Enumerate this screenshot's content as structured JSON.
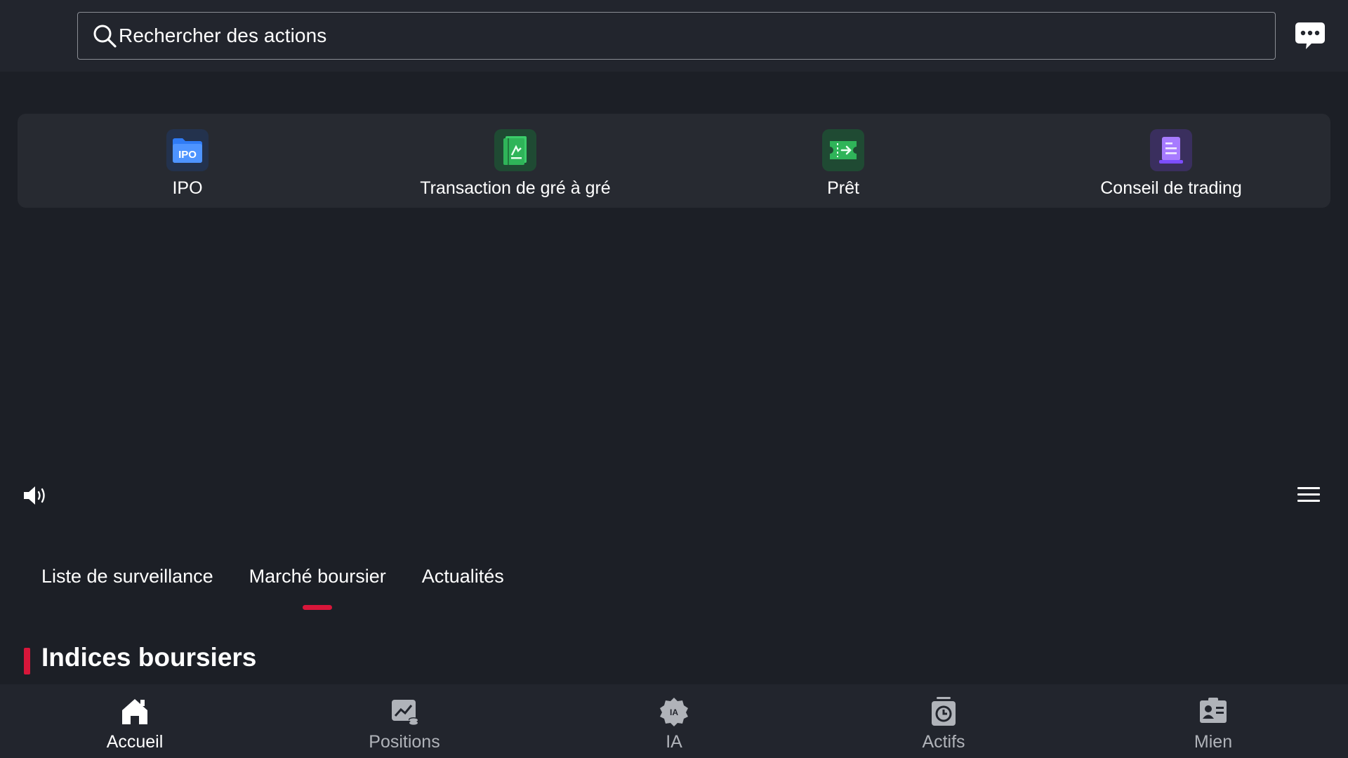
{
  "search": {
    "placeholder": "Rechercher des actions"
  },
  "header": {
    "chat_icon": "chat-bubble-icon"
  },
  "quick_actions": [
    {
      "label": "IPO",
      "icon": "ipo-folder-icon",
      "color": "#2f7bf5"
    },
    {
      "label": "Transaction de gré à gré",
      "icon": "otc-book-icon",
      "color": "#2fb459"
    },
    {
      "label": "Prêt",
      "icon": "loan-ticket-icon",
      "color": "#2fb459"
    },
    {
      "label": "Conseil de trading",
      "icon": "trading-advice-doc-icon",
      "color": "#8b5cf6"
    }
  ],
  "tabs": [
    {
      "label": "Liste de surveillance",
      "active": false
    },
    {
      "label": "Marché boursier",
      "active": true
    },
    {
      "label": "Actualités",
      "active": false
    }
  ],
  "section": {
    "title": "Indices boursiers"
  },
  "accent_color": "#d8163a",
  "bottom_nav": [
    {
      "label": "Accueil",
      "icon": "home-icon",
      "active": true
    },
    {
      "label": "Positions",
      "icon": "positions-chart-icon",
      "active": false
    },
    {
      "label": "IA",
      "icon": "ai-badge-icon",
      "active": false
    },
    {
      "label": "Actifs",
      "icon": "assets-clock-icon",
      "active": false
    },
    {
      "label": "Mien",
      "icon": "profile-card-icon",
      "active": false
    }
  ]
}
